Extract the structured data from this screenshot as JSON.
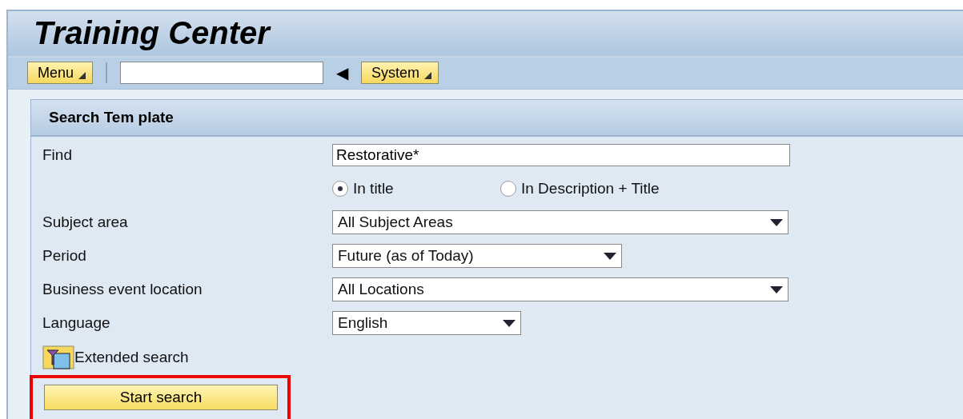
{
  "window": {
    "title": "Training Center"
  },
  "toolbar": {
    "menu_button": "Menu",
    "back_glyph": "◀",
    "system_button": "System"
  },
  "panel": {
    "title": "Search Tem plate",
    "find": {
      "label": "Find",
      "value": "Restorative*"
    },
    "search_scope": [
      {
        "label": "In title",
        "selected": true
      },
      {
        "label": "In Description + Title",
        "selected": false
      }
    ],
    "fields": [
      {
        "label": "Subject area",
        "value": "All Subject Areas"
      },
      {
        "label": "Period",
        "value": "Future (as of Today)"
      },
      {
        "label": "Business event location",
        "value": "All Locations"
      },
      {
        "label": "Language",
        "value": "English"
      }
    ],
    "extended_search": "Extended search",
    "start_button": {
      "label": "Start search",
      "highlighted": true
    }
  }
}
